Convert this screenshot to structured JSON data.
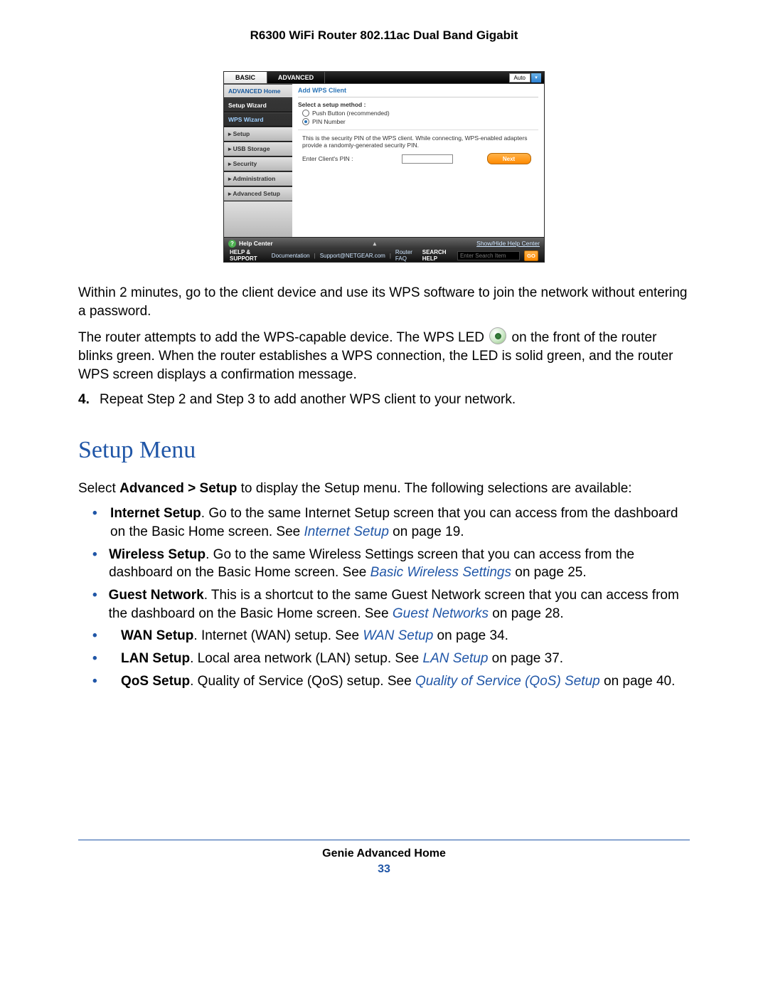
{
  "header": {
    "title": "R6300 WiFi Router 802.11ac Dual Band Gigabit"
  },
  "ui": {
    "tabs": {
      "basic": "BASIC",
      "advanced": "ADVANCED",
      "auto": "Auto"
    },
    "sidebar": {
      "home": "ADVANCED Home",
      "setup_wizard": "Setup Wizard",
      "wps_wizard": "WPS Wizard",
      "setup": "▸ Setup",
      "usb": "▸ USB Storage",
      "security": "▸ Security",
      "admin": "▸ Administration",
      "adv": "▸ Advanced Setup"
    },
    "content": {
      "title": "Add WPS Client",
      "select_label": "Select a setup method :",
      "opt_push": "Push Button (recommended)",
      "opt_pin": "PIN Number",
      "desc": "This is the security PIN of the WPS client. While connecting, WPS-enabled adapters provide a randomly-generated security PIN.",
      "enter_pin": "Enter Client's PIN :",
      "next": "Next"
    },
    "helpbar": {
      "title": "Help Center",
      "toggle": "Show/Hide Help Center"
    },
    "footer": {
      "hs": "HELP & SUPPORT",
      "doc": "Documentation",
      "support": "Support@NETGEAR.com",
      "faq": "Router FAQ",
      "search_label": "SEARCH HELP",
      "search_ph": "Enter Search Item",
      "go": "GO"
    }
  },
  "doc": {
    "p1": "Within 2 minutes, go to the client device and use its WPS software to join the network without entering a password.",
    "p2a": "The router attempts to add the WPS-capable device. The WPS LED ",
    "p2b": " on the front of the router blinks green. When the router establishes a WPS connection, the LED is solid green, and the router WPS screen displays a confirmation message.",
    "step4_num": "4.",
    "step4": "Repeat Step 2 and Step 3 to add another WPS client to your network.",
    "h2": "Setup Menu",
    "intro_a": "Select ",
    "intro_b": "Advanced > Setup",
    "intro_c": " to display the Setup menu. The following selections are available:",
    "bullets": {
      "b1": {
        "bold": "Internet Setup",
        "text": ". Go to the same Internet Setup screen that you can access from the dashboard on the Basic Home screen. See ",
        "link": "Internet Setup",
        "tail": " on page 19."
      },
      "b2": {
        "bold": "Wireless Setup",
        "text": ". Go to the same Wireless Settings screen that you can access from the dashboard on the Basic Home screen. See ",
        "link": "Basic Wireless Settings",
        "tail": " on page 25."
      },
      "b3": {
        "bold": "Guest Network",
        "text": ". This is a shortcut to the same Guest Network screen that you can access from the dashboard on the Basic Home screen. See ",
        "link": "Guest Networks",
        "tail": " on page 28."
      },
      "b4": {
        "bold": "WAN Setup",
        "text": ". Internet (WAN) setup. See ",
        "link": "WAN Setup",
        "tail": " on page 34."
      },
      "b5": {
        "bold": "LAN Setup",
        "text": ". Local area network (LAN) setup. See ",
        "link": "LAN Setup",
        "tail": " on page 37."
      },
      "b6": {
        "bold": "QoS Setup",
        "text": ". Quality of Service (QoS) setup. See ",
        "link": "Quality of Service (QoS) Setup",
        "tail": " on page 40."
      }
    }
  },
  "footer": {
    "label": "Genie Advanced Home",
    "page": "33"
  }
}
